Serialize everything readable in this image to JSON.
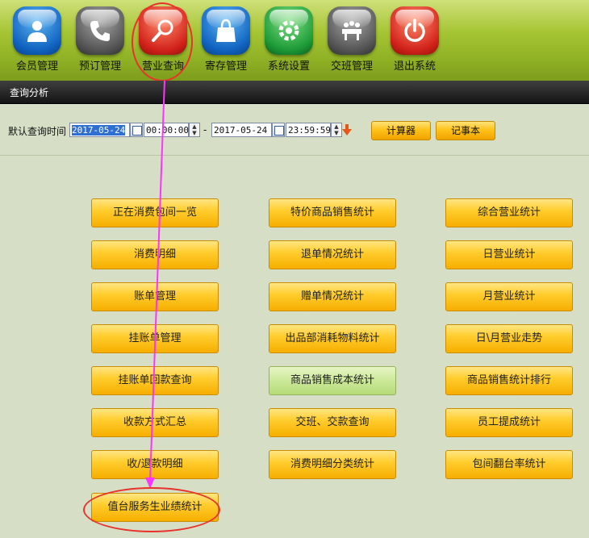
{
  "nav": [
    {
      "id": "member",
      "label": "会员管理",
      "icon": "user-icon",
      "color": "blue"
    },
    {
      "id": "booking",
      "label": "预订管理",
      "icon": "phone-icon",
      "color": "gray"
    },
    {
      "id": "business",
      "label": "营业查询",
      "icon": "search-icon",
      "color": "red"
    },
    {
      "id": "storage",
      "label": "寄存管理",
      "icon": "bag-icon",
      "color": "blue"
    },
    {
      "id": "settings",
      "label": "系统设置",
      "icon": "gear-icon",
      "color": "green"
    },
    {
      "id": "shift",
      "label": "交班管理",
      "icon": "meeting-icon",
      "color": "gray"
    },
    {
      "id": "exit",
      "label": "退出系统",
      "icon": "power-icon",
      "color": "red"
    }
  ],
  "section": {
    "title": "查询分析"
  },
  "query": {
    "label": "默认查询时间",
    "start_date": "2017-05-24",
    "start_time": "00:00:00",
    "separator": "-",
    "end_date": "2017-05-24",
    "end_time": "23:59:59",
    "calculator_label": "计算器",
    "notepad_label": "记事本"
  },
  "reports": {
    "col1": [
      "正在消费包间一览",
      "消费明细",
      "账单管理",
      "挂账单管理",
      "挂账单回款查询",
      "收款方式汇总",
      "收/退款明细",
      "值台服务生业绩统计"
    ],
    "col2": [
      "特价商品销售统计",
      "退单情况统计",
      "赠单情况统计",
      "出品部消耗物料统计",
      "商品销售成本统计",
      "交班、交款查询",
      "消费明细分类统计"
    ],
    "col3": [
      "综合营业统计",
      "日营业统计",
      "月营业统计",
      "日\\月营业走势",
      "商品销售统计排行",
      "员工提成统计",
      "包间翻台率统计"
    ],
    "active": "商品销售成本统计"
  },
  "colors": {
    "accent": "#ffc21a",
    "active": "#c9e796",
    "annotation": "#e8322b",
    "arrow": "#ff33ff"
  }
}
